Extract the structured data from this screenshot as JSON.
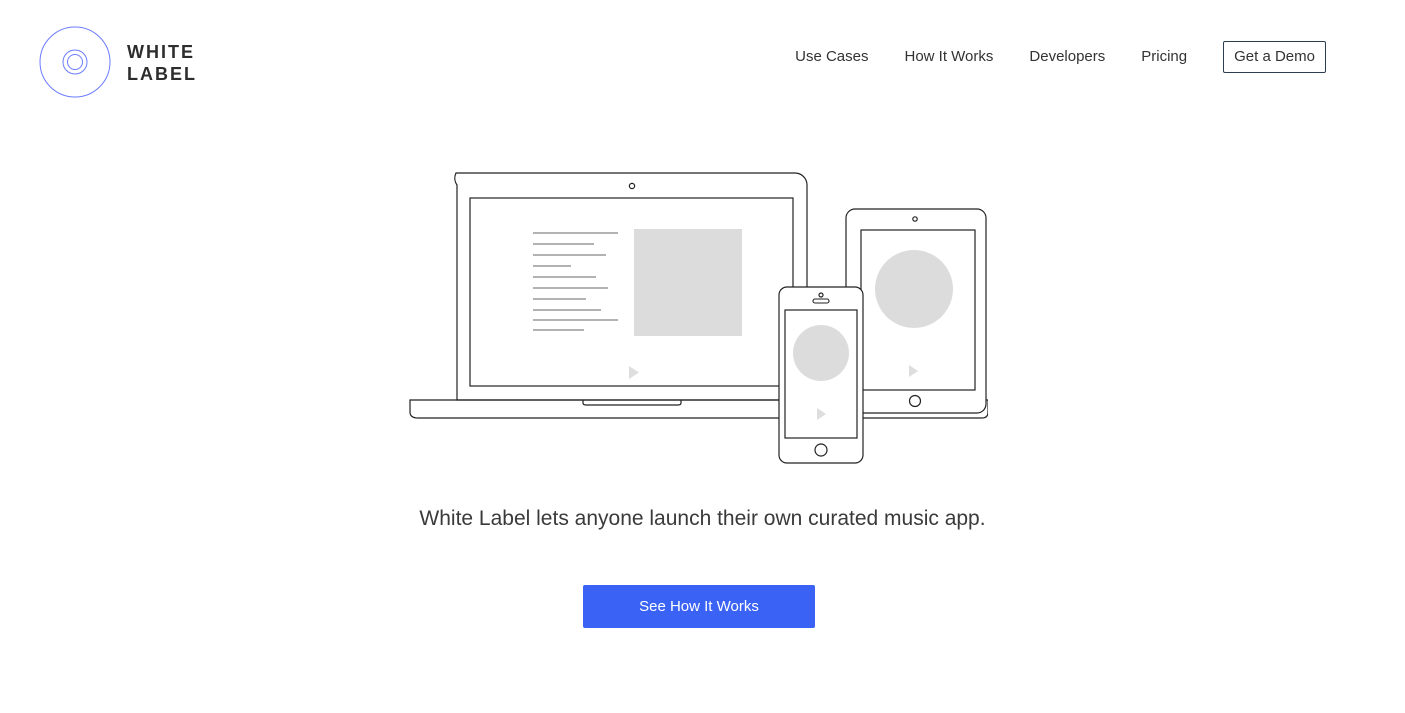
{
  "brand": {
    "line1": "WHITE",
    "line2": "LABEL",
    "accent_color": "#6b7cff"
  },
  "nav": {
    "items": [
      {
        "label": "Use Cases"
      },
      {
        "label": "How It Works"
      },
      {
        "label": "Developers"
      },
      {
        "label": "Pricing"
      }
    ],
    "demo_label": "Get a Demo"
  },
  "hero": {
    "illustration": [
      "laptop-icon",
      "tablet-icon",
      "phone-icon"
    ],
    "tagline": "White Label lets anyone launch their own curated music app.",
    "cta_label": "See How It Works",
    "cta_color": "#3a63f5"
  }
}
